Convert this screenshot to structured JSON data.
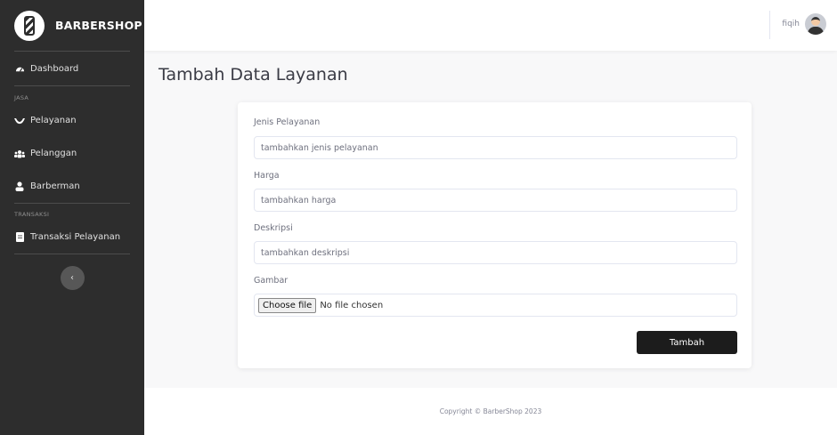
{
  "sidebar": {
    "brand": "BARBERSHOP",
    "dashboard": "Dashboard",
    "heading_jasa": "JASA",
    "items_jasa": [
      "Pelayanan",
      "Pelanggan",
      "Barberman"
    ],
    "heading_transaksi": "TRANSAKSI",
    "transaksi_item": "Transaksi Pelayanan",
    "toggle_icon": "chevron-left-icon"
  },
  "topbar": {
    "username": "fiqih"
  },
  "main": {
    "title": "Tambah Data Layanan",
    "form": {
      "jenis_label": "Jenis Pelayanan",
      "jenis_placeholder": "tambahkan jenis pelayanan",
      "harga_label": "Harga",
      "harga_placeholder": "tambahkan harga",
      "deskripsi_label": "Deskripsi",
      "deskripsi_placeholder": "tambahkan deskripsi",
      "gambar_label": "Gambar",
      "file_button": "Choose file",
      "file_status": "No file chosen",
      "submit": "Tambah"
    }
  },
  "footer": {
    "text": "Copyright © BarberShop 2023"
  }
}
